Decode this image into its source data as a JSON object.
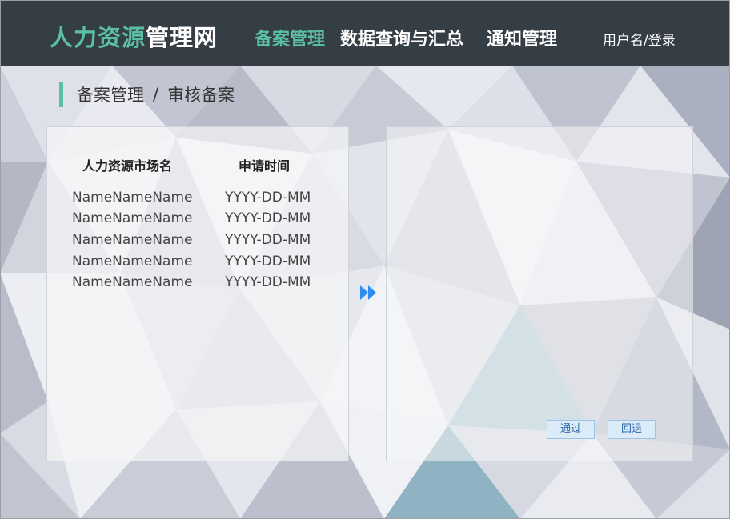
{
  "header": {
    "brand_part1": "人力资源",
    "brand_part2": "管理网",
    "nav": [
      "备案管理",
      "数据查询与汇总",
      "通知管理"
    ],
    "active_nav": "备案管理",
    "user_label": "用户名/登录"
  },
  "breadcrumb": {
    "section": "备案管理",
    "separator": "/",
    "page": "审核备案"
  },
  "list": {
    "columns": [
      "人力资源市场名",
      "申请时间"
    ],
    "rows": [
      [
        "NameNameName",
        "YYYY-DD-MM"
      ],
      [
        "NameNameName",
        "YYYY-DD-MM"
      ],
      [
        "NameNameName",
        "YYYY-DD-MM"
      ],
      [
        "NameNameName",
        "YYYY-DD-MM"
      ],
      [
        "NameNameName",
        "YYYY-DD-MM"
      ]
    ]
  },
  "actions": {
    "approve_label": "通过",
    "return_label": "回退"
  },
  "icons": {
    "transfer": "double-chevron-right-icon"
  },
  "colors": {
    "header_bg": "#353d45",
    "accent": "#5bbfa5",
    "arrow": "#2f8cf0",
    "button_bg": "#dcebf8",
    "button_text": "#2a66a8"
  }
}
